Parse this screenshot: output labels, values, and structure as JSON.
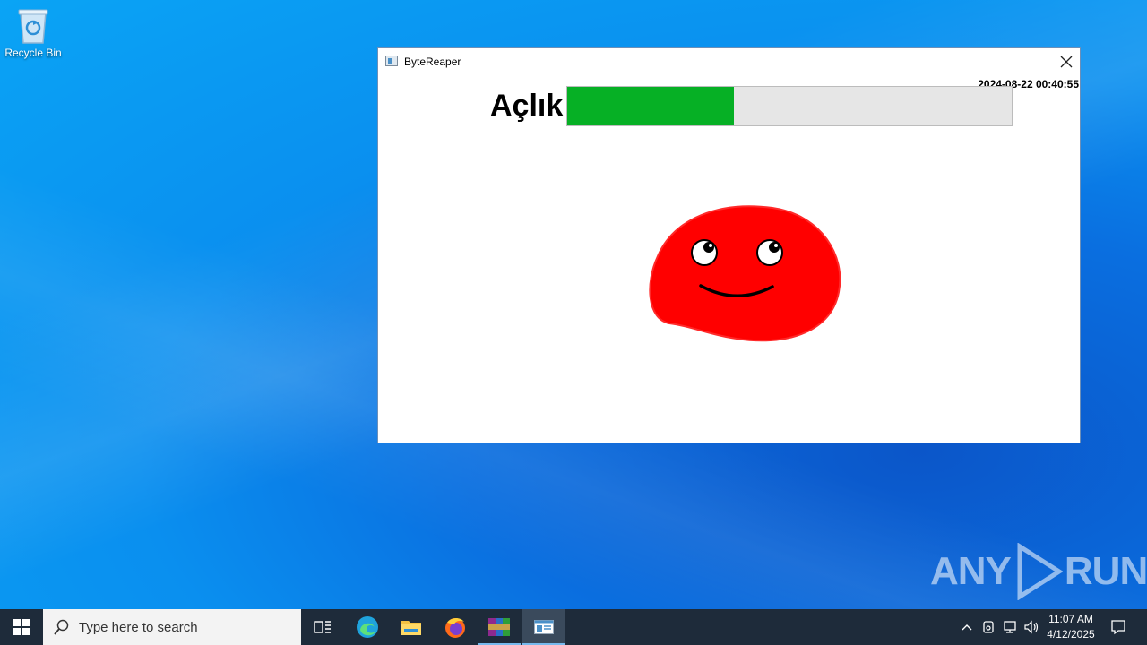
{
  "desktop": {
    "icons": [
      {
        "label": "Recycle Bin",
        "icon": "recycle-bin-icon"
      }
    ]
  },
  "window": {
    "title": "ByteReaper",
    "timestamp": "2024-08-22 00:40:55",
    "hunger": {
      "label": "Açlık",
      "level": 0.375,
      "fill_color": "#06b025",
      "track_color": "#e6e6e6"
    },
    "pet": {
      "color": "#ff0000",
      "expression": "smile"
    }
  },
  "taskbar": {
    "search_placeholder": "Type here to search",
    "apps": [
      "task-view-icon",
      "edge-icon",
      "file-explorer-icon",
      "firefox-icon",
      "winrar-icon",
      "bytereaper-app-icon"
    ],
    "clock": {
      "time": "11:07 AM",
      "date": "4/12/2025"
    }
  },
  "watermark": {
    "left": "ANY",
    "right": "RUN"
  }
}
